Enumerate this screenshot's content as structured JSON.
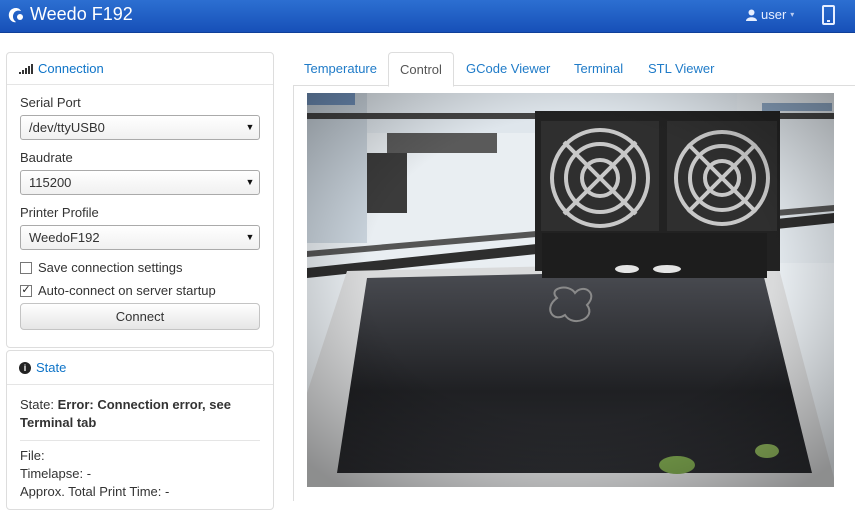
{
  "navbar": {
    "title": "Weedo F192",
    "user_label": "user",
    "caret": "▾"
  },
  "connection": {
    "title": "Connection",
    "serial_port_label": "Serial Port",
    "serial_port_value": "/dev/ttyUSB0",
    "baudrate_label": "Baudrate",
    "baudrate_value": "115200",
    "profile_label": "Printer Profile",
    "profile_value": "WeedoF192",
    "save_settings_label": "Save connection settings",
    "save_settings_checked": false,
    "autoconnect_label": "Auto-connect on server startup",
    "autoconnect_checked": true,
    "checkmark": "✓",
    "connect_button": "Connect"
  },
  "state": {
    "title": "State",
    "state_prefix": "State:",
    "state_value": "Error: Connection error, see Terminal tab",
    "file_label": "File:",
    "timelapse_label": "Timelapse:",
    "timelapse_value": "-",
    "print_time_label": "Approx. Total Print Time:",
    "print_time_value": "-"
  },
  "tabs": [
    {
      "label": "Temperature",
      "active": false
    },
    {
      "label": "Control",
      "active": true
    },
    {
      "label": "GCode Viewer",
      "active": false
    },
    {
      "label": "Terminal",
      "active": false
    },
    {
      "label": "STL Viewer",
      "active": false
    }
  ],
  "icons": {
    "select_arrow": "▼",
    "info": "ℹ"
  },
  "colors": {
    "navbar": "#1f5fc8",
    "link": "#0e74c8"
  }
}
